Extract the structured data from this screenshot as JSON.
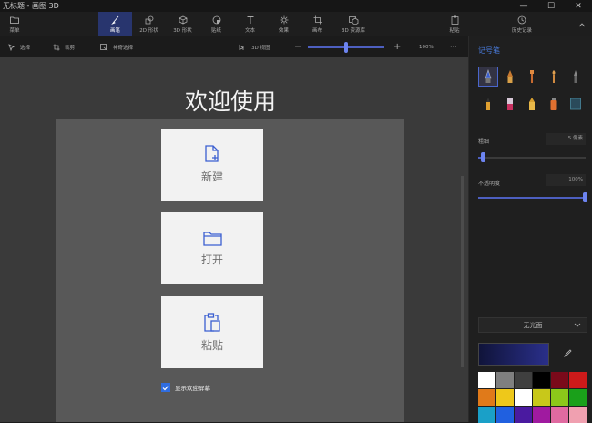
{
  "window": {
    "title": "无标题 - 画图 3D",
    "minimize": "—",
    "maximize": "☐",
    "close": "✕"
  },
  "ribbon": {
    "menu": "菜单",
    "tabs": [
      {
        "label": "画笔",
        "icon": "brush-icon",
        "active": true
      },
      {
        "label": "2D 形状",
        "icon": "2d-shapes-icon"
      },
      {
        "label": "3D 形状",
        "icon": "3d-shapes-icon"
      },
      {
        "label": "贴纸",
        "icon": "stickers-icon"
      },
      {
        "label": "文本",
        "icon": "text-icon"
      },
      {
        "label": "效果",
        "icon": "effects-icon"
      },
      {
        "label": "画布",
        "icon": "canvas-icon"
      },
      {
        "label": "3D 资源库",
        "icon": "3d-library-icon"
      }
    ],
    "paste": "粘贴",
    "history": "历史记录"
  },
  "toolbar": {
    "select": "选择",
    "crop": "裁剪",
    "magic_select": "神奇选择",
    "view3d": "3D 视图",
    "zoom": "100%",
    "more": "···"
  },
  "welcome": {
    "title": "欢迎使用",
    "new": "新建",
    "open": "打开",
    "paste": "粘贴",
    "show_welcome": "显示欢迎屏幕"
  },
  "panel": {
    "title": "记号笔",
    "thickness_label": "粗细",
    "thickness_value": "5 像素",
    "opacity_label": "不透明度",
    "opacity_value": "100%",
    "finish": "无光面",
    "accent": "#4a7de0",
    "palette": [
      "#ffffff",
      "#7f7f7f",
      "#3f3f3f",
      "#000000",
      "#7a0a1a",
      "#cc1a1a",
      "#e07a1a",
      "#eec81a",
      "#ffffff",
      "#c8c81a",
      "#8cc81a",
      "#1aa01a",
      "#1aa0c8",
      "#2060e0",
      "#4a1aa0",
      "#a01aa0",
      "#e06aa0",
      "#f0a0b0"
    ]
  }
}
